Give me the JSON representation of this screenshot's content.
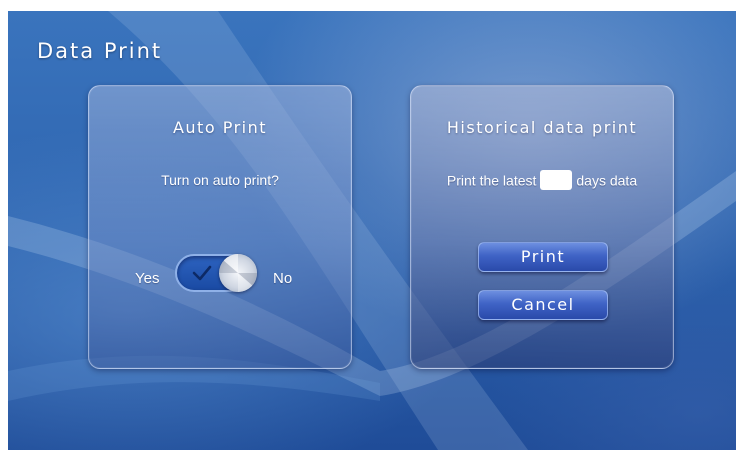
{
  "header": {
    "title": "Data Print"
  },
  "auto_print": {
    "heading": "Auto Print",
    "prompt": "Turn on auto print?",
    "yes_label": "Yes",
    "no_label": "No",
    "toggle_state": "yes"
  },
  "historical": {
    "heading": "Historical data print",
    "prefix": "Print the latest",
    "suffix": "days data",
    "days_value": "",
    "print_label": "Print",
    "cancel_label": "Cancel"
  },
  "colors": {
    "background": "#2f66b1",
    "button": "#3f63c6",
    "toggle": "#1a4aa3",
    "text": "#ffffff"
  },
  "icons": {
    "toggle_check": "check-icon",
    "toggle_knob": "knob-icon"
  }
}
